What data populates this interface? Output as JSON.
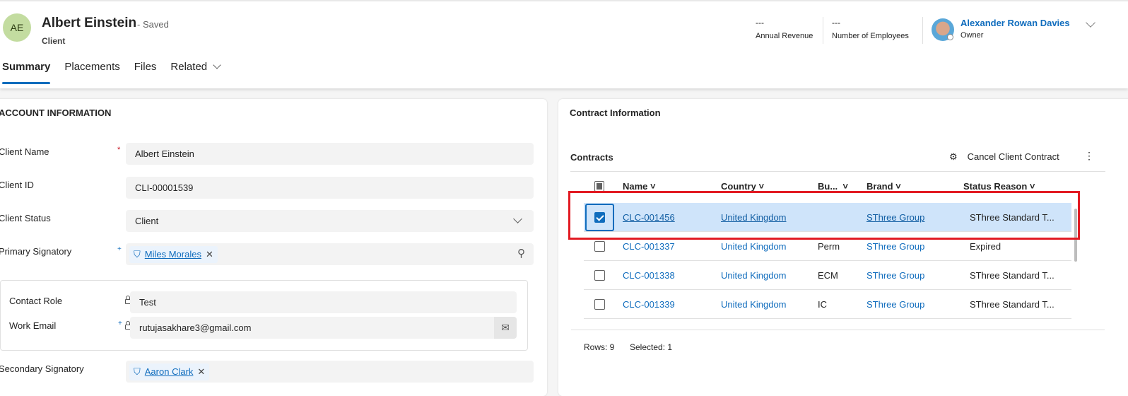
{
  "header": {
    "initials": "AE",
    "title": "Albert Einstein",
    "saved": "- Saved",
    "entity": "Client",
    "kpis": [
      {
        "value": "---",
        "label": "Annual Revenue"
      },
      {
        "value": "---",
        "label": "Number of Employees"
      }
    ],
    "owner": {
      "name": "Alexander Rowan Davies",
      "role": "Owner"
    }
  },
  "tabs": [
    "Summary",
    "Placements",
    "Files",
    "Related"
  ],
  "account": {
    "section": "ACCOUNT INFORMATION",
    "client_name": {
      "label": "Client Name",
      "value": "Albert Einstein"
    },
    "client_id": {
      "label": "Client ID",
      "value": "CLI-00001539"
    },
    "client_status": {
      "label": "Client Status",
      "value": "Client"
    },
    "primary_signatory": {
      "label": "Primary Signatory",
      "value": "Miles Morales"
    },
    "contact_role": {
      "label": "Contact Role",
      "value": "Test"
    },
    "work_email": {
      "label": "Work Email",
      "value": "rutujasakhare3@gmail.com"
    },
    "secondary_signatory": {
      "label": "Secondary Signatory",
      "value": "Aaron Clark"
    }
  },
  "contracts": {
    "section": "Contract Information",
    "title": "Contracts",
    "cancel_label": "Cancel Client Contract",
    "columns": [
      "Name",
      "Country",
      "Bu...",
      "Brand",
      "Status Reason"
    ],
    "rows": [
      {
        "name": "CLC-001456",
        "country": "United Kingdom",
        "bu": "",
        "brand": "SThree Group",
        "status": "SThree Standard T..."
      },
      {
        "name": "CLC-001337",
        "country": "United Kingdom",
        "bu": "Perm",
        "brand": "SThree Group",
        "status": "Expired"
      },
      {
        "name": "CLC-001338",
        "country": "United Kingdom",
        "bu": "ECM",
        "brand": "SThree Group",
        "status": "SThree Standard T..."
      },
      {
        "name": "CLC-001339",
        "country": "United Kingdom",
        "bu": "IC",
        "brand": "SThree Group",
        "status": "SThree Standard T..."
      }
    ],
    "rows_count": "Rows: 9",
    "selected": "Selected: 1"
  }
}
